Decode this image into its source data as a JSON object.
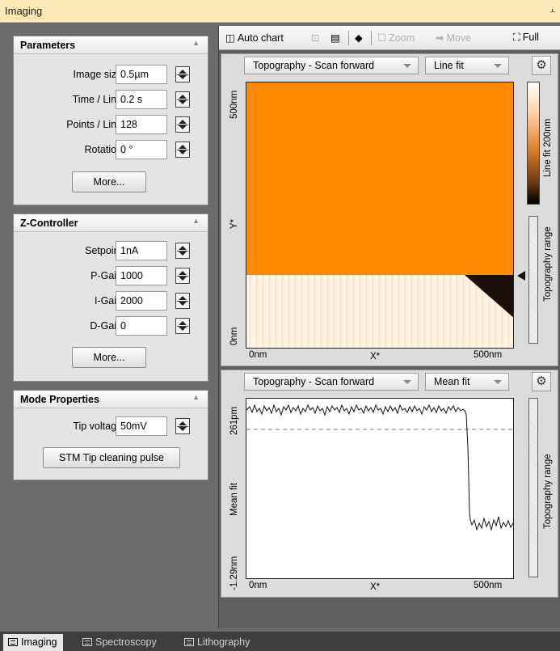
{
  "window": {
    "title": "Imaging",
    "pin_icon": "pin-icon"
  },
  "parameters": {
    "title": "Parameters",
    "rows": [
      {
        "label": "Image size",
        "value": "0.5µm"
      },
      {
        "label": "Time / Line",
        "value": "0.2 s"
      },
      {
        "label": "Points / Line",
        "value": "128"
      },
      {
        "label": "Rotation",
        "value": "0 °"
      }
    ],
    "more_label": "More..."
  },
  "zcontroller": {
    "title": "Z-Controller",
    "rows": [
      {
        "label": "Setpoint",
        "value": "1nA"
      },
      {
        "label": "P-Gain",
        "value": "1000"
      },
      {
        "label": "I-Gain",
        "value": "2000"
      },
      {
        "label": "D-Gain",
        "value": "0"
      }
    ],
    "more_label": "More..."
  },
  "mode": {
    "title": "Mode Properties",
    "rows": [
      {
        "label": "Tip voltage",
        "value": "50mV"
      }
    ],
    "pulse_label": "STM Tip cleaning pulse"
  },
  "toolbar": {
    "auto_chart": "Auto chart",
    "zoom": "Zoom",
    "move": "Move",
    "full": "Full"
  },
  "chart1": {
    "channel": "Topography - Scan forward",
    "filter": "Line fit",
    "y_top": "500nm",
    "y_bottom": "0nm",
    "y_axis": "Y*",
    "x_left": "0nm",
    "x_right": "500nm",
    "x_axis": "X*",
    "colorbar_label": "Line fit 200nm",
    "range_label": "Topography range",
    "colors": {
      "high": "#ff8a00",
      "low": "#fff4e8"
    }
  },
  "chart2": {
    "channel": "Topography - Scan forward",
    "filter": "Mean fit",
    "y_top": "261pm",
    "y_bottom": "-1.29nm",
    "y_axis": "Mean fit",
    "x_left": "0nm",
    "x_right": "500nm",
    "x_axis": "X*",
    "range_label": "Topography range"
  },
  "tabs": [
    {
      "label": "Imaging",
      "active": true
    },
    {
      "label": "Spectroscopy",
      "active": false
    },
    {
      "label": "Lithography",
      "active": false
    }
  ]
}
